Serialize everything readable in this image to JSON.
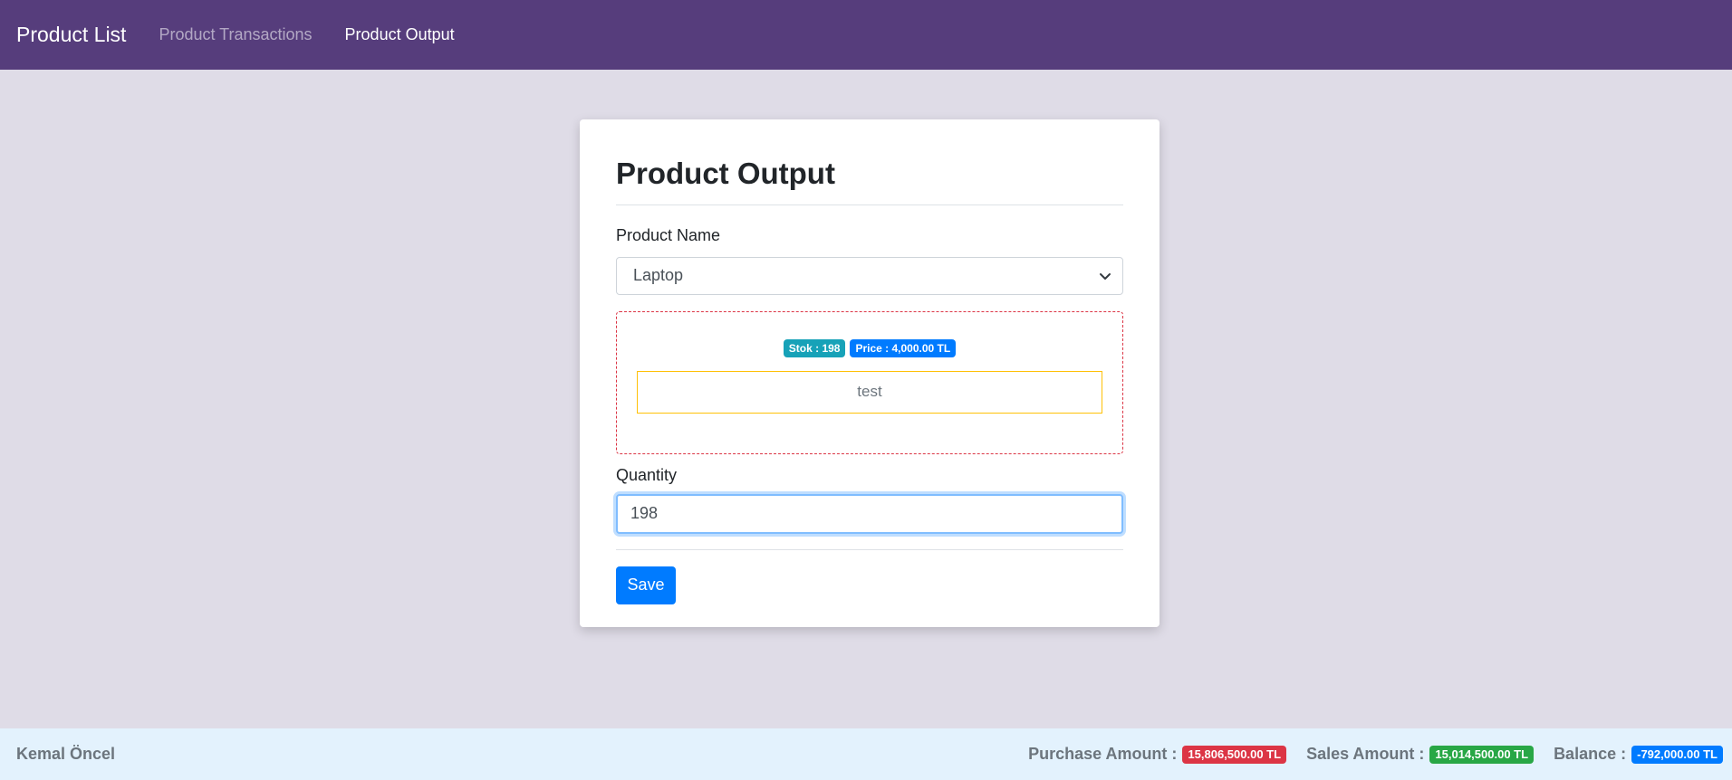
{
  "navbar": {
    "brand": "Product List",
    "links": [
      {
        "label": "Product Transactions",
        "state": "muted"
      },
      {
        "label": "Product Output",
        "state": "active"
      }
    ]
  },
  "form": {
    "title": "Product Output",
    "product_name_label": "Product Name",
    "product_selected": "Laptop",
    "stock_badge": "Stok : 198",
    "price_badge": "Price : 4,000.00 TL",
    "note": "test",
    "quantity_label": "Quantity",
    "quantity_value": "198",
    "save_label": "Save"
  },
  "footer": {
    "user": "Kemal Öncel",
    "purchase_label": "Purchase Amount :",
    "purchase_value": "15,806,500.00 TL",
    "sales_label": "Sales Amount :",
    "sales_value": "15,014,500.00 TL",
    "balance_label": "Balance :",
    "balance_value": "-792,000.00 TL"
  },
  "colors": {
    "navbar": "#563d7c",
    "background": "#dfdce7",
    "footer": "#e3f2fd",
    "primary": "#007bff",
    "info": "#17a2b8",
    "danger": "#dc3545",
    "success": "#28a745",
    "warning": "#ffc107"
  }
}
